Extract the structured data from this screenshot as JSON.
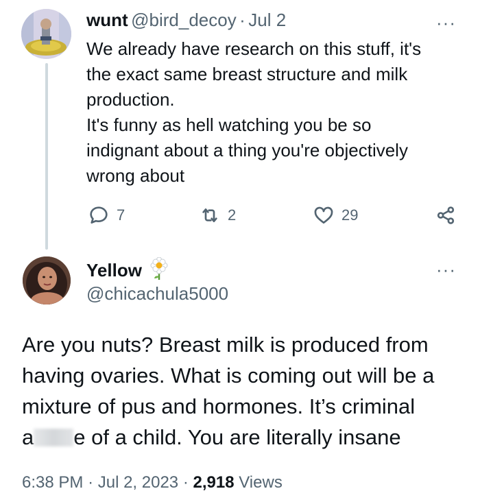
{
  "reply": {
    "display_name": "wunt",
    "handle": "@bird_decoy",
    "separator": "·",
    "date": "Jul 2",
    "lines": [
      "We already have research on this stuff, it's",
      "the exact same breast structure and milk",
      "production.",
      "It's funny as hell watching you be so",
      "indignant about a thing you're objectively",
      "wrong about"
    ],
    "replies_count": "7",
    "retweets_count": "2",
    "likes_count": "29",
    "more_label": "···"
  },
  "main": {
    "display_name": "Yellow",
    "handle": "@chicachula5000",
    "more_label": "···",
    "line1": "Are you nuts? Breast milk is produced from",
    "line2": "having ovaries. What is coming out will be a",
    "line3": "mixture of pus and hormones. It’s criminal",
    "line4_prefix": "a",
    "line4_suffix": "e of a child. You are literally insane",
    "time": "6:38 PM",
    "separator": "·",
    "date": "Jul 2, 2023",
    "views_count": "2,918",
    "views_label": "Views"
  },
  "colors": {
    "text": "#0f1419",
    "secondary": "#536471",
    "thread_line": "#cfd9de"
  }
}
